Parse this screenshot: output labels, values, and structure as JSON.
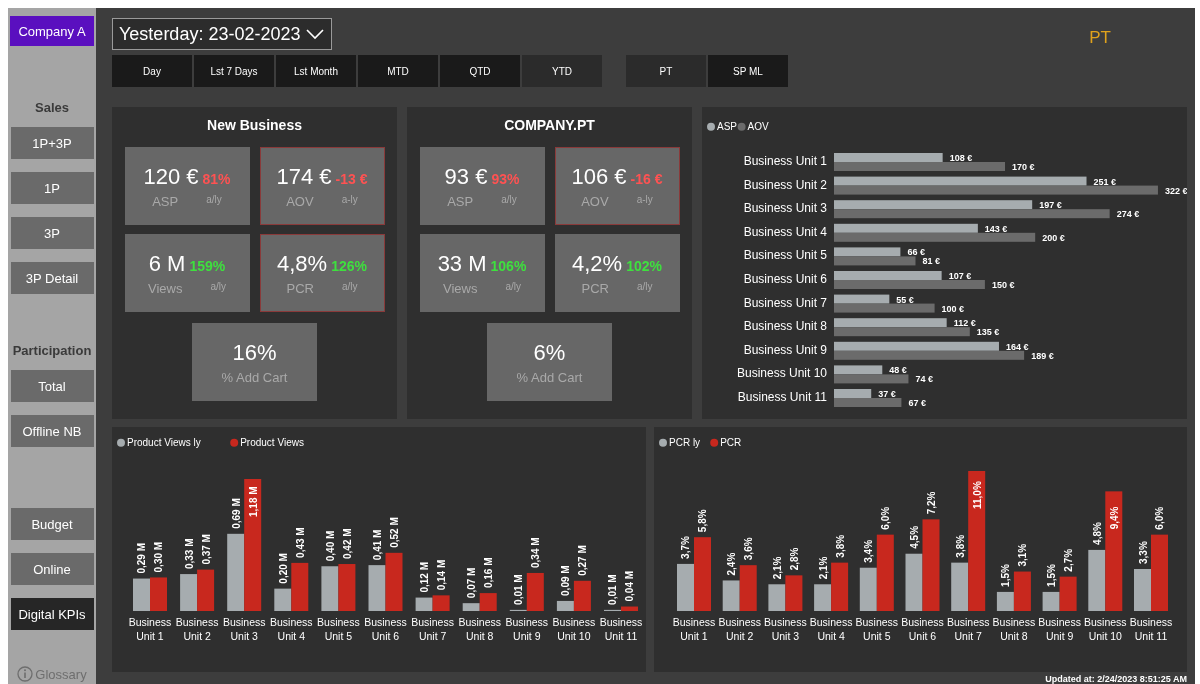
{
  "sidebar": {
    "company_button": "Company A",
    "sections": [
      {
        "heading": "Sales",
        "items": [
          {
            "label": "1P+3P",
            "selected": false
          },
          {
            "label": "1P",
            "selected": false
          },
          {
            "label": "3P",
            "selected": false
          },
          {
            "label": "3P Detail",
            "selected": false
          }
        ]
      },
      {
        "heading": "Participation",
        "items": [
          {
            "label": "Total",
            "selected": false
          },
          {
            "label": "Offline NB",
            "selected": false
          }
        ]
      },
      {
        "items": [
          {
            "label": "Budget",
            "selected": false
          },
          {
            "label": "Online",
            "selected": false
          },
          {
            "label": "Digital KPIs",
            "selected": true
          }
        ]
      }
    ],
    "glossary": "Glossary"
  },
  "date_filter": {
    "value": "Yesterday: 23-02-2023"
  },
  "period_tabs": [
    {
      "label": "Day",
      "selected": false
    },
    {
      "label": "Lst 7 Days",
      "selected": false
    },
    {
      "label": "Lst Month",
      "selected": false
    },
    {
      "label": "MTD",
      "selected": false
    },
    {
      "label": "QTD",
      "selected": false
    },
    {
      "label": "YTD",
      "selected": true
    }
  ],
  "market_tabs": [
    {
      "label": "PT",
      "selected": true
    },
    {
      "label": "SP ML",
      "selected": false
    }
  ],
  "market_label": "PT",
  "kpi_panels": [
    {
      "title": "New Business",
      "cards": [
        {
          "value": "120 €",
          "delta": "81%",
          "color": "#ff5252",
          "label": "ASP",
          "delta_label": "a/ly",
          "outlined": false
        },
        {
          "value": "174 €",
          "delta": "-13 €",
          "color": "#ff5252",
          "label": "AOV",
          "delta_label": "a-ly",
          "outlined": true
        },
        {
          "value": "6 M",
          "delta": "159%",
          "color": "#3ee03e",
          "label": "Views",
          "delta_label": "a/ly",
          "outlined": false
        },
        {
          "value": "4,8%",
          "delta": "126%",
          "color": "#3ee03e",
          "label": "PCR",
          "delta_label": "a/ly",
          "outlined": true
        }
      ],
      "add_cart": {
        "value": "16%",
        "label": "% Add Cart"
      }
    },
    {
      "title": "COMPANY.PT",
      "cards": [
        {
          "value": "93 €",
          "delta": "93%",
          "color": "#ff5252",
          "label": "ASP",
          "delta_label": "a/ly",
          "outlined": false
        },
        {
          "value": "106 €",
          "delta": "-16 €",
          "color": "#ff5252",
          "label": "AOV",
          "delta_label": "a-ly",
          "outlined": true
        },
        {
          "value": "33 M",
          "delta": "106%",
          "color": "#3ee03e",
          "label": "Views",
          "delta_label": "a/ly",
          "outlined": false
        },
        {
          "value": "4,2%",
          "delta": "102%",
          "color": "#3ee03e",
          "label": "PCR",
          "delta_label": "a/ly",
          "outlined": false
        }
      ],
      "add_cart": {
        "value": "6%",
        "label": "% Add Cart"
      }
    }
  ],
  "unit_chart": {
    "chart_data": {
      "type": "bar",
      "orientation": "horizontal",
      "legend": "top-left",
      "categories": [
        "Business Unit 1",
        "Business Unit 2",
        "Business Unit 3",
        "Business Unit 4",
        "Business Unit 5",
        "Business Unit 6",
        "Business Unit 7",
        "Business Unit 8",
        "Business Unit 9",
        "Business Unit 10",
        "Business Unit 11"
      ],
      "series": [
        {
          "name": "ASP",
          "color": "#a6acaf",
          "values": [
            108,
            251,
            197,
            143,
            66,
            107,
            55,
            112,
            164,
            48,
            37
          ],
          "value_labels": [
            "108 €",
            "251 €",
            "197 €",
            "143 €",
            "66 €",
            "107 €",
            "55 €",
            "112 €",
            "164 €",
            "48 €",
            "37 €"
          ]
        },
        {
          "name": "AOV",
          "color": "#6b6b6b",
          "values": [
            170,
            322,
            274,
            200,
            81,
            150,
            100,
            135,
            189,
            74,
            67
          ],
          "value_labels": [
            "170 €",
            "322 €",
            "274 €",
            "200 €",
            "81 €",
            "150 €",
            "100 €",
            "135 €",
            "189 €",
            "74 €",
            "67 €"
          ]
        }
      ]
    }
  },
  "views_chart": {
    "chart_data": {
      "type": "bar",
      "orientation": "vertical",
      "legend": "top-left",
      "categories": [
        "Business Unit 1",
        "Business Unit 2",
        "Business Unit 3",
        "Business Unit 4",
        "Business Unit 5",
        "Business Unit 6",
        "Business Unit 7",
        "Business Unit 8",
        "Business Unit 9",
        "Business Unit 10",
        "Business Unit 11"
      ],
      "series": [
        {
          "name": "Product Views ly",
          "color": "#a6acaf",
          "values": [
            0.29,
            0.33,
            0.69,
            0.2,
            0.4,
            0.41,
            0.12,
            0.07,
            0.01,
            0.09,
            0.01
          ],
          "value_labels": [
            "0,29 M",
            "0,33 M",
            "0,69 M",
            "0,20 M",
            "0,40 M",
            "0,41 M",
            "0,12 M",
            "0,07 M",
            "0,01 M",
            "0,09 M",
            "0,01 M"
          ]
        },
        {
          "name": "Product Views",
          "color": "#c8281e",
          "values": [
            0.3,
            0.37,
            1.18,
            0.43,
            0.42,
            0.52,
            0.14,
            0.16,
            0.34,
            0.27,
            0.04
          ],
          "value_labels": [
            "0,30 M",
            "0,37 M",
            "1,18 M",
            "0,43 M",
            "0,42 M",
            "0,52 M",
            "0,14 M",
            "0,16 M",
            "0,34 M",
            "0,27 M",
            "0,04 M"
          ]
        }
      ]
    }
  },
  "pcr_chart": {
    "chart_data": {
      "type": "bar",
      "orientation": "vertical",
      "legend": "top-left",
      "categories": [
        "Business Unit 1",
        "Business Unit 2",
        "Business Unit 3",
        "Business Unit 4",
        "Business Unit 5",
        "Business Unit 6",
        "Business Unit 7",
        "Business Unit 8",
        "Business Unit 9",
        "Business Unit 10",
        "Business Unit 11"
      ],
      "series": [
        {
          "name": "PCR ly",
          "color": "#a6acaf",
          "values": [
            3.7,
            2.4,
            2.1,
            2.1,
            3.4,
            4.5,
            3.8,
            1.5,
            1.5,
            4.8,
            3.3
          ],
          "value_labels": [
            "3,7%",
            "2,4%",
            "2,1%",
            "2,1%",
            "3,4%",
            "4,5%",
            "3,8%",
            "1,5%",
            "1,5%",
            "4,8%",
            "3,3%"
          ]
        },
        {
          "name": "PCR",
          "color": "#c8281e",
          "values": [
            5.8,
            3.6,
            2.8,
            3.8,
            6.0,
            7.2,
            11.0,
            3.1,
            2.7,
            9.4,
            6.0
          ],
          "value_labels": [
            "5,8%",
            "3,6%",
            "2,8%",
            "3,8%",
            "6,0%",
            "7,2%",
            "11,0%",
            "3,1%",
            "2,7%",
            "9,4%",
            "6,0%"
          ]
        }
      ]
    }
  },
  "status_bar": {
    "updated": "Updated at: 2/24/2023 8:51:25 AM"
  }
}
